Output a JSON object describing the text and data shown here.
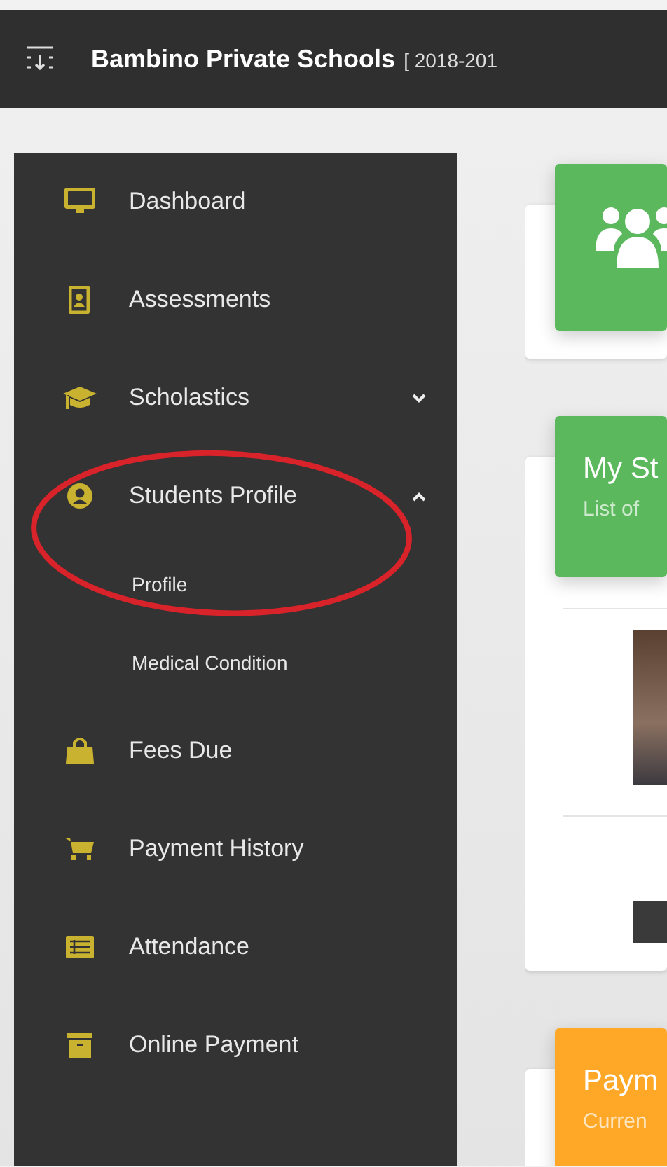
{
  "header": {
    "title": "Bambino Private Schools",
    "session": "[ 2018-201"
  },
  "sidebar": {
    "items": [
      {
        "label": "Dashboard"
      },
      {
        "label": "Assessments"
      },
      {
        "label": "Scholastics",
        "expanded": false
      },
      {
        "label": "Students Profile",
        "expanded": true,
        "children": [
          {
            "label": "Profile"
          },
          {
            "label": "Medical Condition"
          }
        ]
      },
      {
        "label": "Fees Due"
      },
      {
        "label": "Payment History"
      },
      {
        "label": "Attendance"
      },
      {
        "label": "Online Payment"
      }
    ]
  },
  "cards": [
    {
      "kind": "icon",
      "color": "#5cb85c"
    },
    {
      "kind": "list",
      "color": "#5cb85c",
      "title": "My St",
      "subtitle": "List of"
    },
    {
      "kind": "header",
      "color": "#ffa726",
      "title": "Paym",
      "subtitle": "Curren"
    }
  ]
}
